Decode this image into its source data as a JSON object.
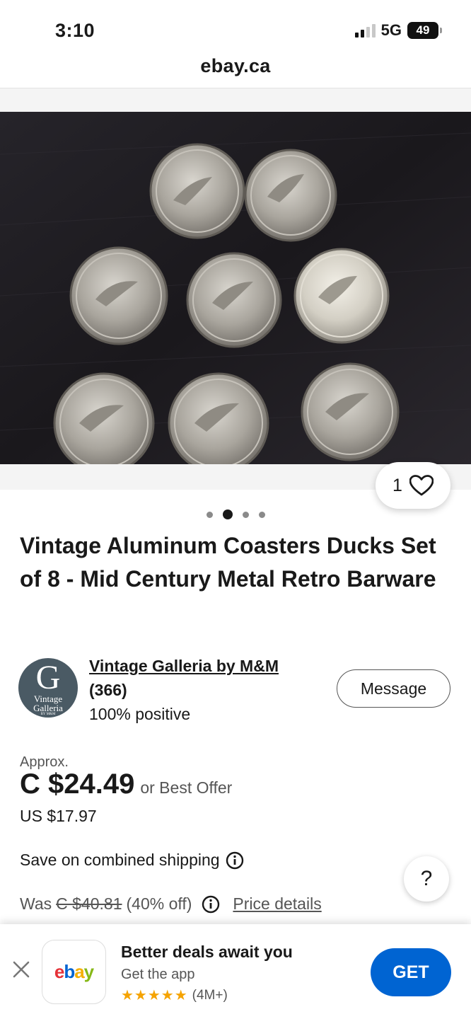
{
  "status_bar": {
    "time": "3:10",
    "network": "5G",
    "battery": "49"
  },
  "browser": {
    "url": "ebay.ca"
  },
  "product": {
    "image_alt": "Aluminum coasters with duck designs on a dark wood surface",
    "like_count": "1",
    "carousel_dots": 4,
    "carousel_active_index": 1,
    "title": "Vintage Aluminum Coasters Ducks Set of 8 - Mid Century Metal Retro Barware"
  },
  "seller": {
    "logo_letter": "G",
    "logo_line1": "Vintage",
    "logo_line2": "Galleria",
    "logo_line3": "BY M&M",
    "name": "Vintage Galleria by M&M",
    "feedback_count": "(366)",
    "positive": "100% positive",
    "message_label": "Message"
  },
  "pricing": {
    "approx_label": "Approx.",
    "price": "C $24.49",
    "best_offer": "or Best Offer",
    "us_price": "US $17.97",
    "shipping_text": "Save on combined shipping",
    "was_label": "Was",
    "was_price": "C $40.81",
    "discount": "(40% off)",
    "price_details_label": "Price details",
    "help_label": "?"
  },
  "app_banner": {
    "title": "Better deals await you",
    "subtitle": "Get the app",
    "stars": "★★★★★",
    "rating_count": "(4M+)",
    "get_label": "GET",
    "logo": {
      "e": "e",
      "b": "b",
      "a": "a",
      "y": "y"
    }
  },
  "colors": {
    "ebay_blue": "#0064d2",
    "ebay_red": "#e53238",
    "ebay_yellow": "#f5af02",
    "ebay_green": "#86b817",
    "star": "#f5a300"
  }
}
